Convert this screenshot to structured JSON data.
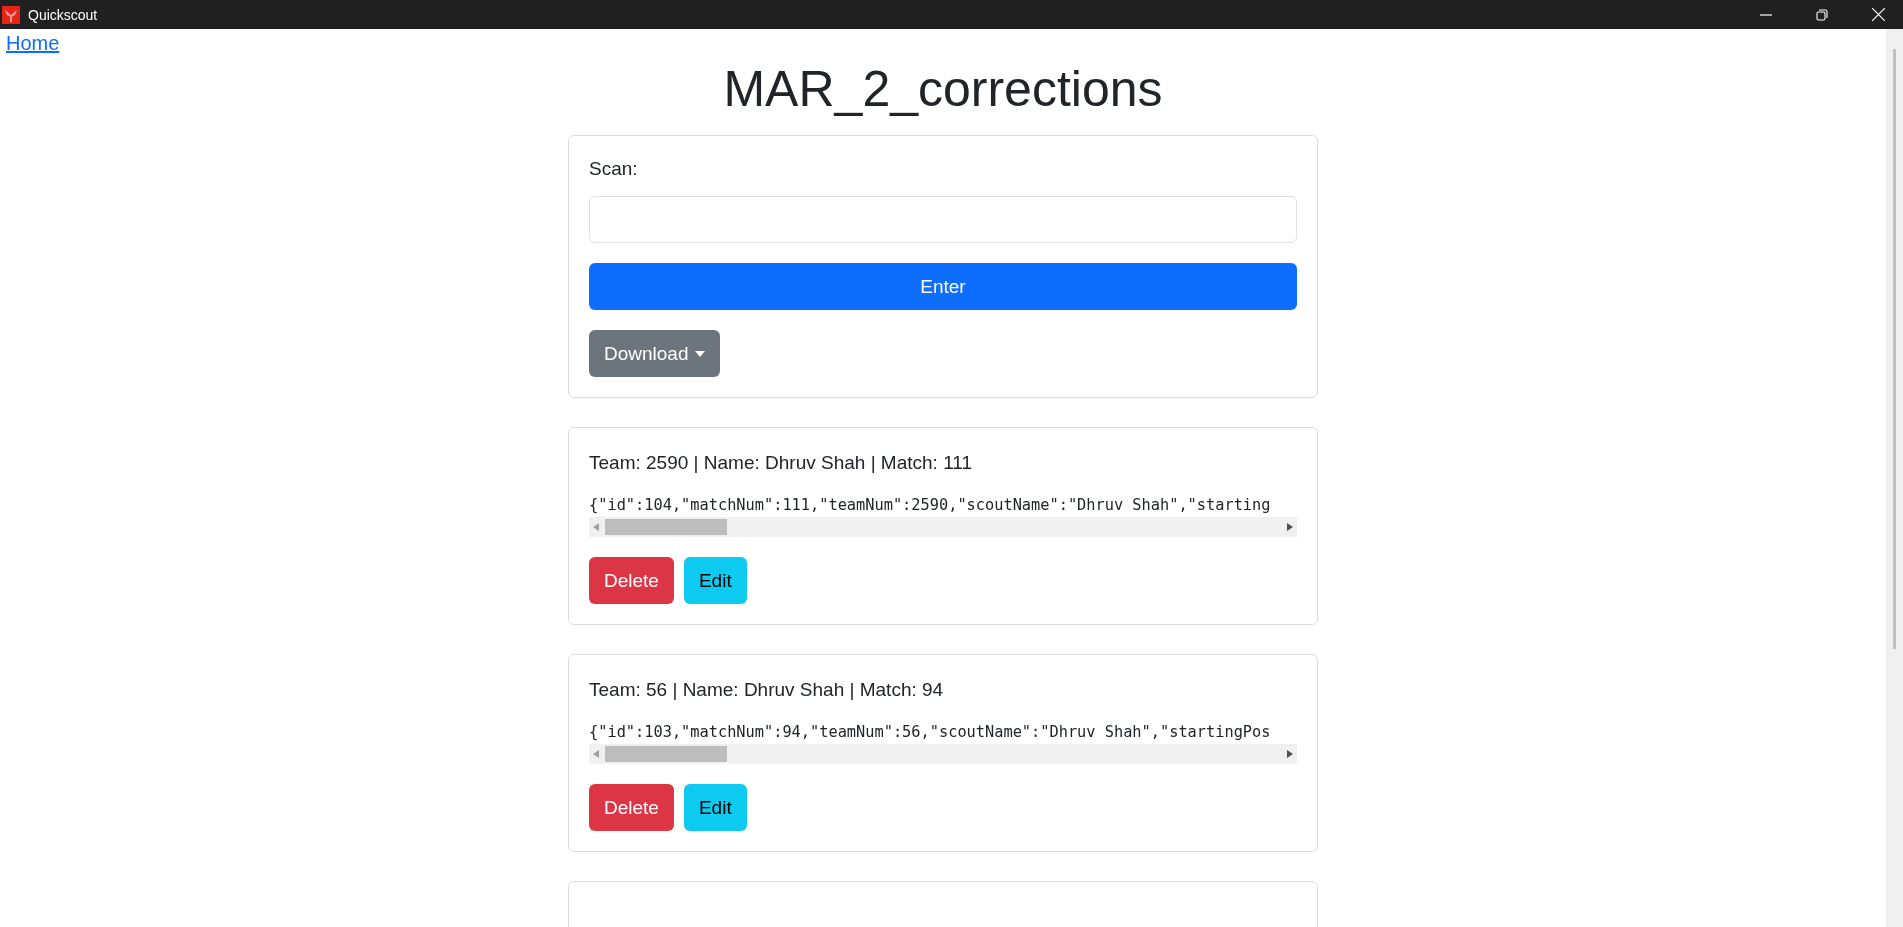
{
  "window": {
    "title": "Quickscout"
  },
  "nav": {
    "home_link": "Home"
  },
  "heading": "MAR_2_corrections",
  "scan_card": {
    "label": "Scan:",
    "enter_button": "Enter",
    "download_button": "Download"
  },
  "entries": [
    {
      "summary": "Team: 2590 | Name: Dhruv Shah | Match: 111",
      "json": "{\"id\":104,\"matchNum\":111,\"teamNum\":2590,\"scoutName\":\"Dhruv Shah\",\"starting",
      "delete_button": "Delete",
      "edit_button": "Edit"
    },
    {
      "summary": "Team: 56 | Name: Dhruv Shah | Match: 94",
      "json": "{\"id\":103,\"matchNum\":94,\"teamNum\":56,\"scoutName\":\"Dhruv Shah\",\"startingPos",
      "delete_button": "Delete",
      "edit_button": "Edit"
    }
  ]
}
